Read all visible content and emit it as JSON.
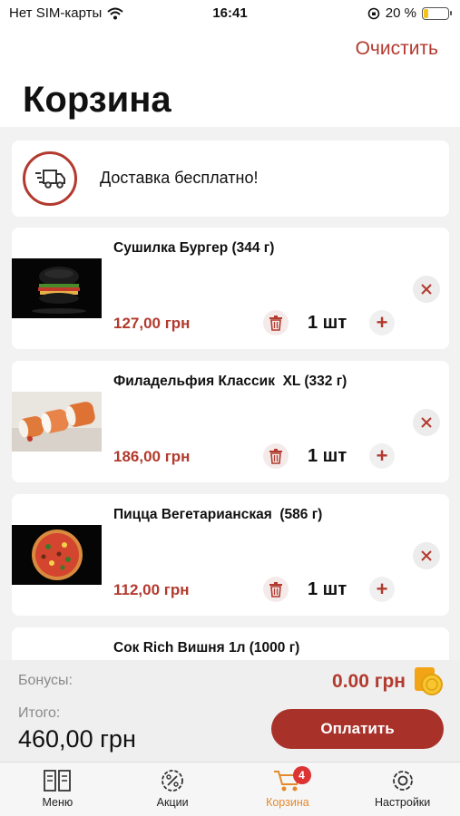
{
  "status_bar": {
    "carrier": "Нет SIM-карты",
    "time": "16:41",
    "battery": "20 %",
    "battery_level": 0.2
  },
  "header": {
    "clear_label": "Очистить",
    "title": "Корзина"
  },
  "delivery": {
    "icon": "delivery-truck-icon",
    "text": "Доставка бесплатно!"
  },
  "cart": {
    "items": [
      {
        "name": "Сушилка Бургер (344 г)",
        "price": "127,00 грн",
        "qty": "1 шт",
        "image": "black-burger-image"
      },
      {
        "name": "Филадельфия Классик  XL (332 г)",
        "price": "186,00 грн",
        "qty": "1 шт",
        "image": "sushi-rolls-image"
      },
      {
        "name": "Пицца Вегетарианская  (586 г)",
        "price": "112,00 грн",
        "qty": "1 шт",
        "image": "pizza-image"
      },
      {
        "name": "Сок Rich Вишня 1л (1000 г)",
        "price": "",
        "qty": "",
        "image": "juice-image"
      }
    ]
  },
  "summary": {
    "bonus_label": "Бонусы:",
    "bonus_value": "0.00 грн",
    "total_label": "Итого:",
    "total_value": "460,00 грн",
    "pay_label": "Оплатить"
  },
  "tabbar": {
    "tabs": [
      {
        "label": "Меню",
        "icon": "menu-book-icon"
      },
      {
        "label": "Акции",
        "icon": "percent-gear-icon"
      },
      {
        "label": "Корзина",
        "icon": "cart-icon",
        "badge": "4"
      },
      {
        "label": "Настройки",
        "icon": "settings-gear-icon"
      }
    ]
  },
  "colors": {
    "accent": "#b23a2e",
    "active_tab": "#e48a2e",
    "pay_button": "#a8322a"
  }
}
